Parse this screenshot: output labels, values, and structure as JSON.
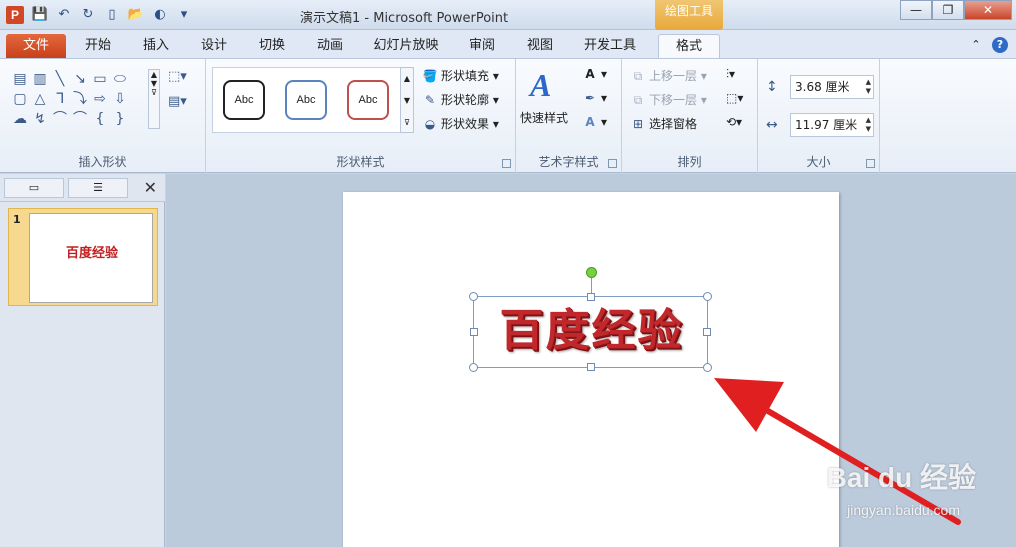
{
  "titlebar": {
    "app_icon": "P",
    "title": "演示文稿1 - Microsoft PowerPoint",
    "context_tab": "绘图工具",
    "qat_icons": [
      "save-icon",
      "undo-icon",
      "redo-icon",
      "new-icon",
      "open-icon",
      "print-icon",
      "customize-icon"
    ],
    "window_buttons": {
      "minimize": "—",
      "restore": "❐",
      "close": "✕"
    }
  },
  "tabs": [
    "文件",
    "开始",
    "插入",
    "设计",
    "切换",
    "动画",
    "幻灯片放映",
    "审阅",
    "视图",
    "开发工具",
    "格式"
  ],
  "active_tab": "格式",
  "ribbon": {
    "insert_shapes": {
      "label": "插入形状"
    },
    "shape_styles": {
      "label": "形状样式",
      "gallery": [
        "Abc",
        "Abc",
        "Abc"
      ],
      "fill": "形状填充",
      "outline": "形状轮廓",
      "effects": "形状效果"
    },
    "wordart": {
      "label": "艺术字样式",
      "quick_styles": "快速样式"
    },
    "arrange": {
      "label": "排列",
      "bring_forward": "上移一层",
      "send_backward": "下移一层",
      "selection_pane": "选择窗格"
    },
    "size": {
      "label": "大小",
      "height": "3.68 厘米",
      "width": "11.97 厘米"
    }
  },
  "left_pane": {
    "slide_number": "1",
    "thumb_text": "百度经验"
  },
  "slide": {
    "word_art": "百度经验"
  },
  "watermark": {
    "brand": "Bai du 经验",
    "url": "jingyan.baidu.com"
  },
  "colors": {
    "file_tab": "#c8401b",
    "context_tab": "#e8a93a",
    "word_art": "#c0282b",
    "arrow": "#e02020"
  }
}
